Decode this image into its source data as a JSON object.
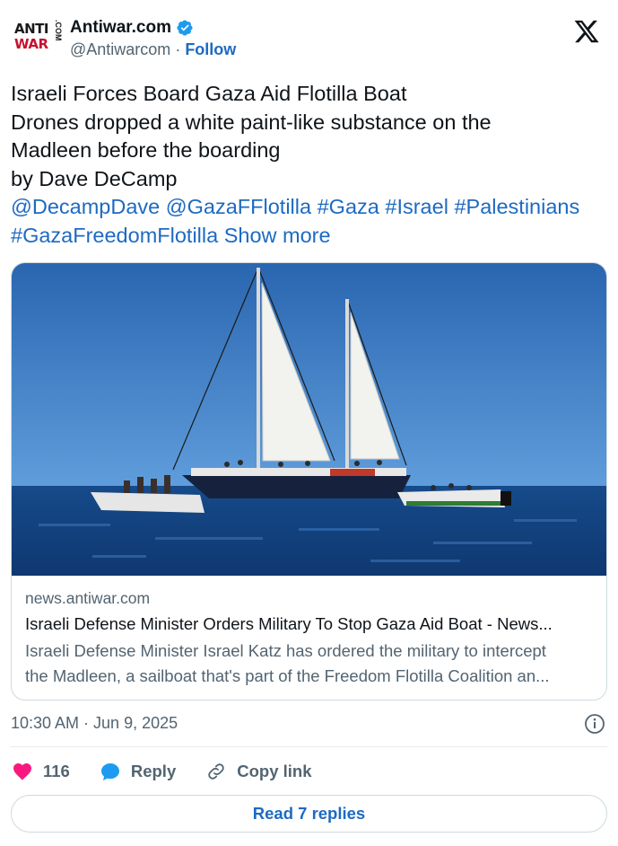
{
  "account": {
    "logo_line1": "ANTI",
    "logo_line2": "WAR",
    "logo_side": ".COM",
    "name": "Antiwar.com",
    "handle": "@Antiwarcom",
    "separator": " · ",
    "follow_label": "Follow"
  },
  "tweet": {
    "lines": [
      "Israeli Forces Board Gaza Aid Flotilla Boat",
      "Drones dropped a white paint-like substance on the",
      "Madleen before the boarding",
      "by Dave DeCamp"
    ],
    "tags_line1": [
      {
        "text": "@DecampDave"
      },
      {
        "text": "@GazaFFlotilla"
      },
      {
        "text": "#Gaza"
      },
      {
        "text": "#Israel"
      },
      {
        "text": "#Palestinians"
      }
    ],
    "tag_last": "#GazaFreedomFlotilla",
    "show_more": "Show more"
  },
  "card": {
    "domain": "news.antiwar.com",
    "title": "Israeli Defense Minister Orders Military To Stop Gaza Aid Boat - News...",
    "desc_line1": "Israeli Defense Minister Israel Katz has ordered the military to intercept",
    "desc_line2": "the Madleen, a sailboat that's part of the Freedom Flotilla Coalition an..."
  },
  "meta": {
    "timestamp": "10:30 AM · Jun 9, 2025"
  },
  "actions": {
    "likes": "116",
    "reply_label": "Reply",
    "copy_label": "Copy link"
  },
  "read_replies": "Read 7 replies",
  "colors": {
    "link": "#1d6ac2",
    "like": "#f91880",
    "reply_icon": "#1d9bf0",
    "verified": "#1d9bf0",
    "sea": "#1f4c86",
    "sky": "#3d7fc8"
  },
  "icons": {
    "verified": "verified-badge-icon",
    "x_logo": "x-logo-icon",
    "info": "info-icon",
    "heart": "heart-icon",
    "reply": "speech-bubble-icon",
    "copy": "link-icon"
  }
}
